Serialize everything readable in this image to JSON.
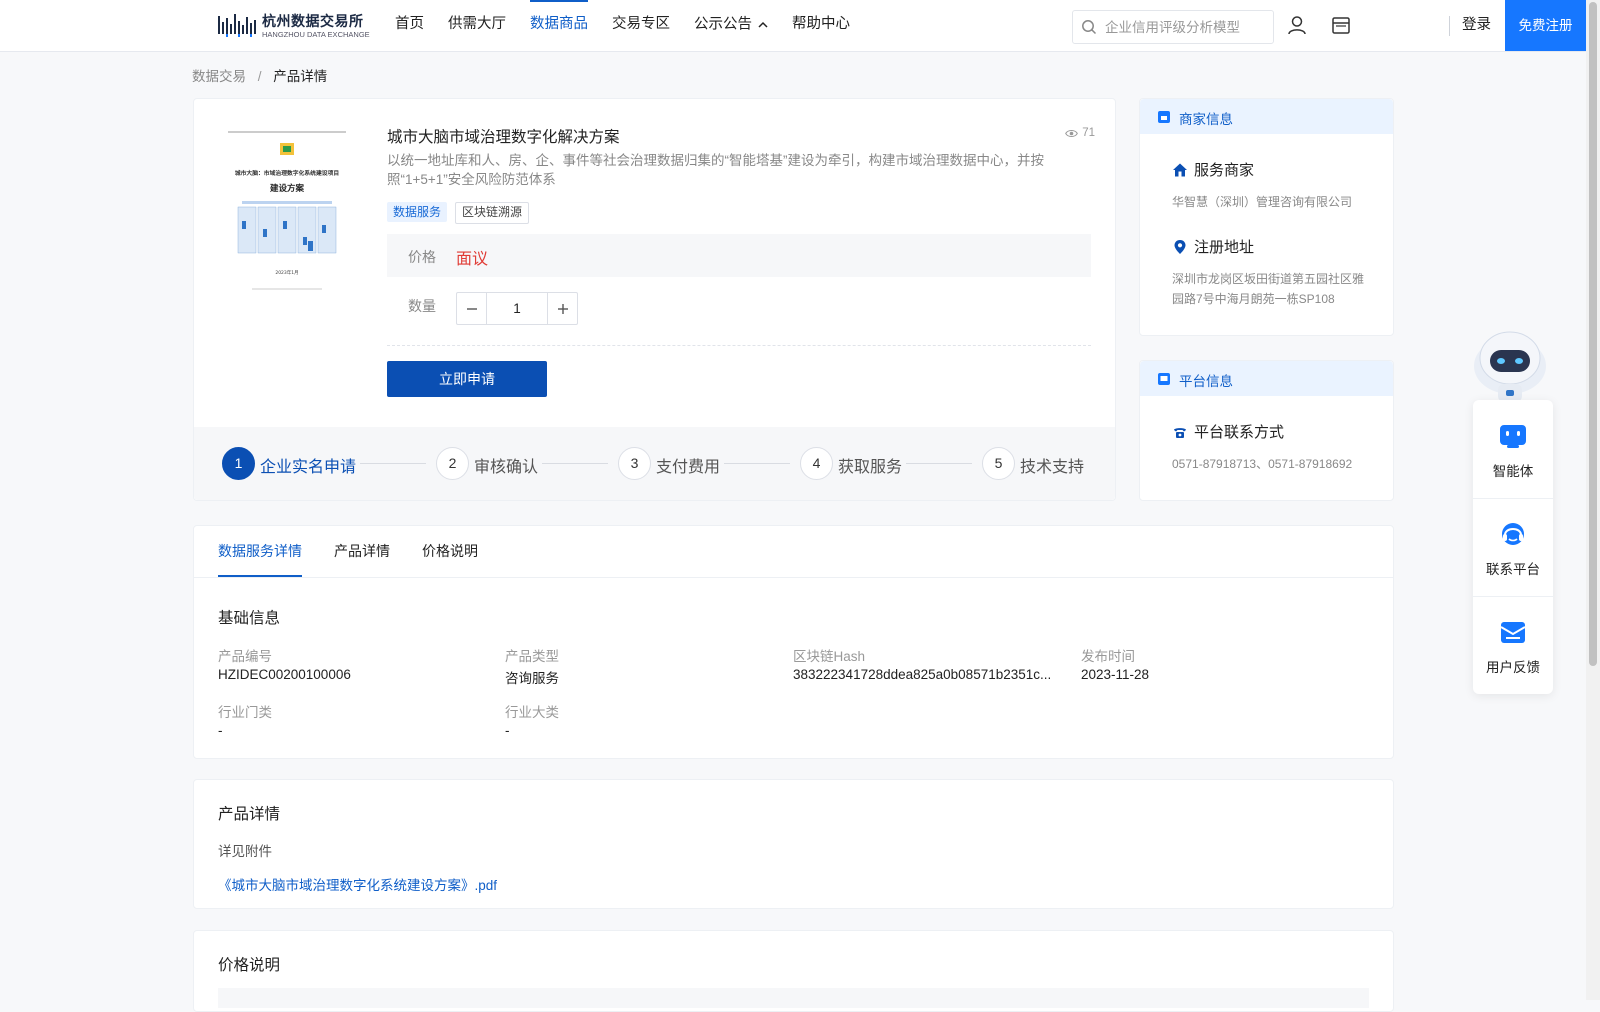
{
  "header": {
    "logo_cn": "杭州数据交易所",
    "logo_en": "HANGZHOU DATA EXCHANGE",
    "nav": [
      {
        "label": "首页",
        "active": false
      },
      {
        "label": "供需大厅",
        "active": false
      },
      {
        "label": "数据商品",
        "active": true
      },
      {
        "label": "交易专区",
        "active": false
      },
      {
        "label": "公示公告",
        "active": false,
        "has_dropdown": true
      },
      {
        "label": "帮助中心",
        "active": false
      }
    ],
    "search_placeholder": "企业信用评级分析模型",
    "user_icon": "user-icon",
    "store_icon": "store-icon",
    "login": "登录",
    "register": "免费注册"
  },
  "breadcrumb": {
    "root": "数据交易",
    "separator": "/",
    "current": "产品详情"
  },
  "product": {
    "title": "城市大脑市域治理数字化解决方案",
    "views": "71",
    "description": "以统一地址库和人、房、企、事件等社会治理数据归集的“智能塔基”建设为牵引，构建市域治理数据中心，并按照“1+5+1”安全风险防范体系",
    "tags": [
      "数据服务",
      "区块链溯源"
    ],
    "price_label": "价格",
    "price_value": "面议",
    "qty_label": "数量",
    "qty_value": "1",
    "apply_button": "立即申请",
    "thumb_title": "城市大脑：市域治理数字化系统建设项目",
    "thumb_subtitle": "建设方案",
    "thumb_date": "2023年1月"
  },
  "steps": [
    {
      "num": "1",
      "label": "企业实名申请",
      "active": true
    },
    {
      "num": "2",
      "label": "审核确认",
      "active": false
    },
    {
      "num": "3",
      "label": "支付费用",
      "active": false
    },
    {
      "num": "4",
      "label": "获取服务",
      "active": false
    },
    {
      "num": "5",
      "label": "技术支持",
      "active": false
    }
  ],
  "merchant": {
    "heading": "商家信息",
    "provider_label": "服务商家",
    "provider_name": "华智慧（深圳）管理咨询有限公司",
    "address_label": "注册地址",
    "address": "深圳市龙岗区坂田街道第五园社区雅园路7号中海月朗苑一栋SP108"
  },
  "platform": {
    "heading": "平台信息",
    "contact_label": "平台联系方式",
    "contact": "0571-87918713、0571-87918692"
  },
  "tabs": [
    "数据服务详情",
    "产品详情",
    "价格说明"
  ],
  "basic_info": {
    "title": "基础信息",
    "fields": [
      {
        "label": "产品编号",
        "value": "HZIDEC00200100006"
      },
      {
        "label": "产品类型",
        "value": "咨询服务"
      },
      {
        "label": "区块链Hash",
        "value": "383222341728ddea825a0b08571b2351c..."
      },
      {
        "label": "发布时间",
        "value": "2023-11-28"
      },
      {
        "label": "行业门类",
        "value": "-"
      },
      {
        "label": "行业大类",
        "value": "-"
      }
    ]
  },
  "product_detail": {
    "title": "产品详情",
    "text": "详见附件",
    "attachment": "《城市大脑市域治理数字化系统建设方案》.pdf"
  },
  "price_section": {
    "title": "价格说明"
  },
  "float_tools": [
    {
      "label": "智能体",
      "icon": "agent-icon"
    },
    {
      "label": "联系平台",
      "icon": "headset-icon"
    },
    {
      "label": "用户反馈",
      "icon": "feedback-icon"
    }
  ],
  "colors": {
    "primary": "#0b4fb3",
    "accent": "#1677ff",
    "price": "#e03b35",
    "link": "#0f5ec8"
  }
}
